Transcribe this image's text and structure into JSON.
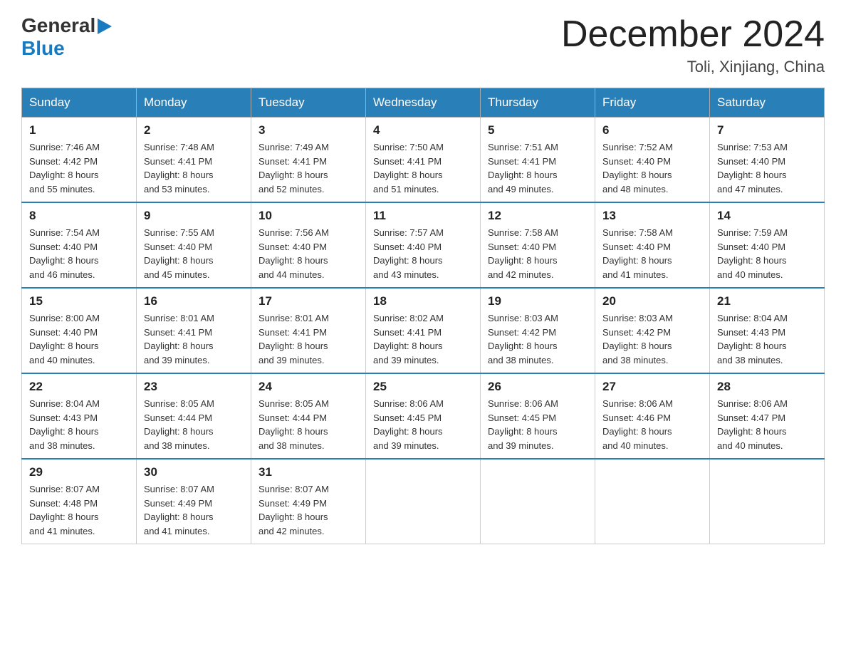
{
  "logo": {
    "general": "General",
    "blue": "Blue",
    "arrow": "▶"
  },
  "title": {
    "month": "December 2024",
    "location": "Toli, Xinjiang, China"
  },
  "header_days": [
    "Sunday",
    "Monday",
    "Tuesday",
    "Wednesday",
    "Thursday",
    "Friday",
    "Saturday"
  ],
  "weeks": [
    [
      {
        "day": "1",
        "sunrise": "7:46 AM",
        "sunset": "4:42 PM",
        "daylight": "8 hours and 55 minutes."
      },
      {
        "day": "2",
        "sunrise": "7:48 AM",
        "sunset": "4:41 PM",
        "daylight": "8 hours and 53 minutes."
      },
      {
        "day": "3",
        "sunrise": "7:49 AM",
        "sunset": "4:41 PM",
        "daylight": "8 hours and 52 minutes."
      },
      {
        "day": "4",
        "sunrise": "7:50 AM",
        "sunset": "4:41 PM",
        "daylight": "8 hours and 51 minutes."
      },
      {
        "day": "5",
        "sunrise": "7:51 AM",
        "sunset": "4:41 PM",
        "daylight": "8 hours and 49 minutes."
      },
      {
        "day": "6",
        "sunrise": "7:52 AM",
        "sunset": "4:40 PM",
        "daylight": "8 hours and 48 minutes."
      },
      {
        "day": "7",
        "sunrise": "7:53 AM",
        "sunset": "4:40 PM",
        "daylight": "8 hours and 47 minutes."
      }
    ],
    [
      {
        "day": "8",
        "sunrise": "7:54 AM",
        "sunset": "4:40 PM",
        "daylight": "8 hours and 46 minutes."
      },
      {
        "day": "9",
        "sunrise": "7:55 AM",
        "sunset": "4:40 PM",
        "daylight": "8 hours and 45 minutes."
      },
      {
        "day": "10",
        "sunrise": "7:56 AM",
        "sunset": "4:40 PM",
        "daylight": "8 hours and 44 minutes."
      },
      {
        "day": "11",
        "sunrise": "7:57 AM",
        "sunset": "4:40 PM",
        "daylight": "8 hours and 43 minutes."
      },
      {
        "day": "12",
        "sunrise": "7:58 AM",
        "sunset": "4:40 PM",
        "daylight": "8 hours and 42 minutes."
      },
      {
        "day": "13",
        "sunrise": "7:58 AM",
        "sunset": "4:40 PM",
        "daylight": "8 hours and 41 minutes."
      },
      {
        "day": "14",
        "sunrise": "7:59 AM",
        "sunset": "4:40 PM",
        "daylight": "8 hours and 40 minutes."
      }
    ],
    [
      {
        "day": "15",
        "sunrise": "8:00 AM",
        "sunset": "4:40 PM",
        "daylight": "8 hours and 40 minutes."
      },
      {
        "day": "16",
        "sunrise": "8:01 AM",
        "sunset": "4:41 PM",
        "daylight": "8 hours and 39 minutes."
      },
      {
        "day": "17",
        "sunrise": "8:01 AM",
        "sunset": "4:41 PM",
        "daylight": "8 hours and 39 minutes."
      },
      {
        "day": "18",
        "sunrise": "8:02 AM",
        "sunset": "4:41 PM",
        "daylight": "8 hours and 39 minutes."
      },
      {
        "day": "19",
        "sunrise": "8:03 AM",
        "sunset": "4:42 PM",
        "daylight": "8 hours and 38 minutes."
      },
      {
        "day": "20",
        "sunrise": "8:03 AM",
        "sunset": "4:42 PM",
        "daylight": "8 hours and 38 minutes."
      },
      {
        "day": "21",
        "sunrise": "8:04 AM",
        "sunset": "4:43 PM",
        "daylight": "8 hours and 38 minutes."
      }
    ],
    [
      {
        "day": "22",
        "sunrise": "8:04 AM",
        "sunset": "4:43 PM",
        "daylight": "8 hours and 38 minutes."
      },
      {
        "day": "23",
        "sunrise": "8:05 AM",
        "sunset": "4:44 PM",
        "daylight": "8 hours and 38 minutes."
      },
      {
        "day": "24",
        "sunrise": "8:05 AM",
        "sunset": "4:44 PM",
        "daylight": "8 hours and 38 minutes."
      },
      {
        "day": "25",
        "sunrise": "8:06 AM",
        "sunset": "4:45 PM",
        "daylight": "8 hours and 39 minutes."
      },
      {
        "day": "26",
        "sunrise": "8:06 AM",
        "sunset": "4:45 PM",
        "daylight": "8 hours and 39 minutes."
      },
      {
        "day": "27",
        "sunrise": "8:06 AM",
        "sunset": "4:46 PM",
        "daylight": "8 hours and 40 minutes."
      },
      {
        "day": "28",
        "sunrise": "8:06 AM",
        "sunset": "4:47 PM",
        "daylight": "8 hours and 40 minutes."
      }
    ],
    [
      {
        "day": "29",
        "sunrise": "8:07 AM",
        "sunset": "4:48 PM",
        "daylight": "8 hours and 41 minutes."
      },
      {
        "day": "30",
        "sunrise": "8:07 AM",
        "sunset": "4:49 PM",
        "daylight": "8 hours and 41 minutes."
      },
      {
        "day": "31",
        "sunrise": "8:07 AM",
        "sunset": "4:49 PM",
        "daylight": "8 hours and 42 minutes."
      },
      null,
      null,
      null,
      null
    ]
  ],
  "labels": {
    "sunrise": "Sunrise: ",
    "sunset": "Sunset: ",
    "daylight": "Daylight: "
  }
}
